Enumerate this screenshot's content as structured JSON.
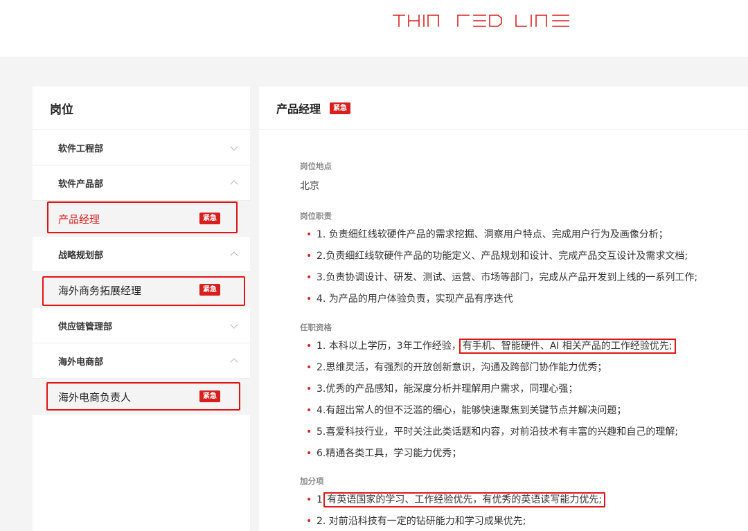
{
  "logo": {
    "text": "THIN RED LINE",
    "color": "#d71f1f"
  },
  "sidebar": {
    "title": "岗位",
    "departments": [
      {
        "name": "软件工程部",
        "expanded": false,
        "jobs": []
      },
      {
        "name": "软件产品部",
        "expanded": true,
        "jobs": [
          {
            "title": "产品经理",
            "badge": "紧急",
            "active": true
          }
        ]
      },
      {
        "name": "战略规划部",
        "expanded": true,
        "jobs": [
          {
            "title": "海外商务拓展经理",
            "badge": "紧急",
            "active": false
          }
        ]
      },
      {
        "name": "供应链管理部",
        "expanded": false,
        "jobs": []
      },
      {
        "name": "海外电商部",
        "expanded": true,
        "jobs": [
          {
            "title": "海外电商负责人",
            "badge": "紧急",
            "active": false
          }
        ]
      }
    ]
  },
  "detail": {
    "title": "产品经理",
    "badge": "紧急",
    "location_label": "岗位地点",
    "location": "北京",
    "duties_label": "岗位职责",
    "duties": [
      "1. 负责细红线软硬件产品的需求挖掘、洞察用户特点、完成用户行为及画像分析；",
      "2.负责细红线软硬件产品的功能定义、产品规划和设计、完成产品交互设计及需求文档;",
      "3.负责协调设计、研发、测试、运营、市场等部门，完成从产品开发到上线的一系列工作;",
      "4. 为产品的用户体验负责，实现产品有序迭代"
    ],
    "requirements_label": "任职资格",
    "requirements": [
      {
        "text": "1. 本科以上学历，3年工作经验，",
        "highlight": "有手机、智能硬件、AI 相关产品的工作经验优先;"
      },
      {
        "text": "2.思维灵活，有强烈的开放创新意识，沟通及跨部门协作能力优秀；",
        "highlight": ""
      },
      {
        "text": "3.优秀的产品感知，能深度分析并理解用户需求，同理心强；",
        "highlight": ""
      },
      {
        "text": "4.有超出常人的但不泛滥的细心，能够快速聚焦到关键节点并解决问题；",
        "highlight": ""
      },
      {
        "text": "5.喜爱科技行业，平时关注此类话题和内容，对前沿技术有丰富的兴趣和自己的理解;",
        "highlight": ""
      },
      {
        "text": "6.精通各类工具，学习能力优秀；",
        "highlight": ""
      }
    ],
    "bonus_label": "加分项",
    "bonus": [
      {
        "text": "1.",
        "highlight": "有英语国家的学习、工作经验优先，有优秀的英语读写能力优先;"
      },
      {
        "text": "2. 对前沿科技有一定的钻研能力和学习成果优先;",
        "highlight": ""
      }
    ]
  }
}
